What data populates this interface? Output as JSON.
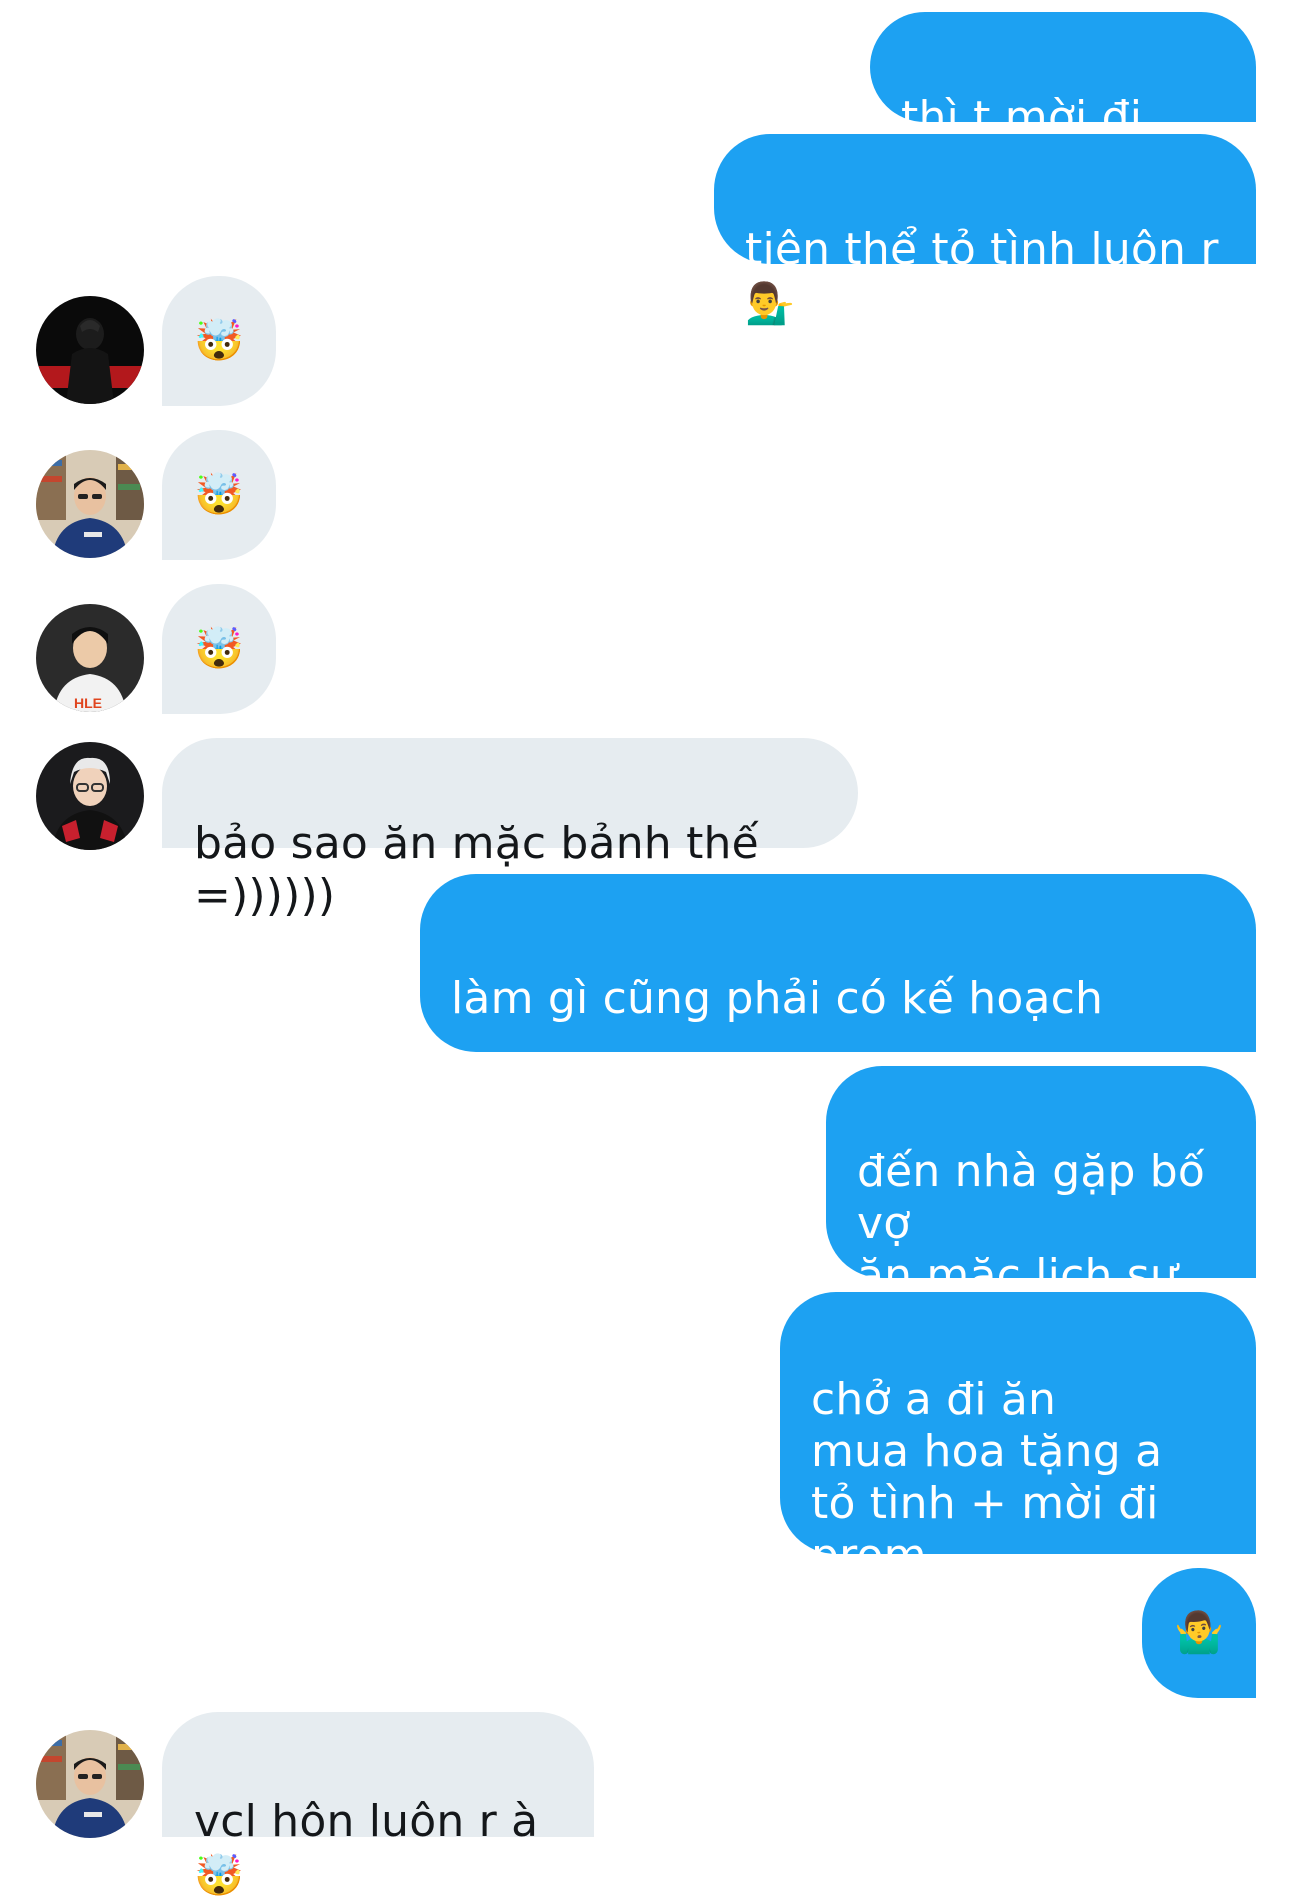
{
  "messages": [
    {
      "id": "m1",
      "side": "out",
      "text": "thì t mời đi prom",
      "emoji": ""
    },
    {
      "id": "m2",
      "side": "out",
      "text": "tiện thể tỏ tình luôn r",
      "emoji": "💁‍♂️"
    },
    {
      "id": "m3",
      "side": "in",
      "text": "",
      "emoji": "🤯",
      "avatar": "avatar-1"
    },
    {
      "id": "m4",
      "side": "in",
      "text": "",
      "emoji": "🤯",
      "avatar": "avatar-2"
    },
    {
      "id": "m5",
      "side": "in",
      "text": "",
      "emoji": "🤯",
      "avatar": "avatar-3"
    },
    {
      "id": "m6",
      "side": "in",
      "text": "bảo sao ăn mặc bảnh thế =))))))",
      "emoji": "",
      "avatar": "avatar-4"
    },
    {
      "id": "m7",
      "side": "out",
      "text": "làm gì cũng phải có kế hoạch cmay\nhiểu ko",
      "emoji": "😌"
    },
    {
      "id": "m8",
      "side": "out",
      "text": "đến nhà gặp bố vợ\năn mặc lịch sự\nghi điểm",
      "emoji": ""
    },
    {
      "id": "m9",
      "side": "out",
      "text": "chở a đi ăn\nmua hoa tặng a\ntỏ tình + mời đi prom\nnụ hôn đầu",
      "emoji": ""
    },
    {
      "id": "m10",
      "side": "out",
      "text": "",
      "emoji": "🤷‍♂️"
    },
    {
      "id": "m11",
      "side": "in",
      "text": "vcl hôn luôn r à",
      "emoji": "🤯",
      "avatar": "avatar-2"
    }
  ],
  "colors": {
    "outgoing_bubble": "#1da1f2",
    "incoming_bubble": "#e6ecf0",
    "outgoing_text": "#ffffff",
    "incoming_text": "#14171a"
  }
}
